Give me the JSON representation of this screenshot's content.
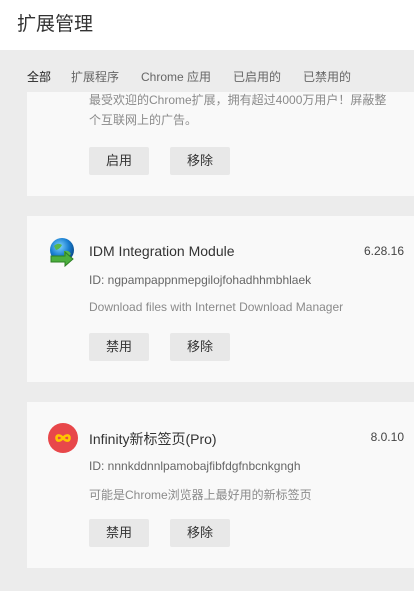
{
  "header": {
    "title": "扩展管理"
  },
  "tabs": [
    {
      "label": "全部",
      "active": true
    },
    {
      "label": "扩展程序"
    },
    {
      "label": "Chrome 应用"
    },
    {
      "label": "已启用的"
    },
    {
      "label": "已禁用的"
    }
  ],
  "extensions": [
    {
      "description": "最受欢迎的Chrome扩展，拥有超过4000万用户！屏蔽整个互联网上的广告。",
      "description_line1": "最受欢迎的Chrome扩展，拥有超过4000万用户！屏蔽整",
      "description_line2": "个互联网上的广告。",
      "primary_button": "启用",
      "remove_button": "移除"
    },
    {
      "name": "IDM Integration Module",
      "version": "6.28.16",
      "id": "ID: ngpampappnmepgilojfohadhhmbhlaek",
      "description": "Download files with Internet Download Manager",
      "primary_button": "禁用",
      "remove_button": "移除",
      "icon": "idm-globe-icon"
    },
    {
      "name": "Infinity新标签页(Pro)",
      "version": "8.0.10",
      "id": "ID: nnnkddnnlpamobajfibfdgfnbcnkgngh",
      "description": "可能是Chrome浏览器上最好用的新标签页",
      "primary_button": "禁用",
      "remove_button": "移除",
      "icon": "infinity-icon"
    }
  ],
  "colors": {
    "background": "#ececec",
    "card": "#f9f9f9",
    "button": "#e8e8e8",
    "infinity_red": "#e8474a"
  }
}
